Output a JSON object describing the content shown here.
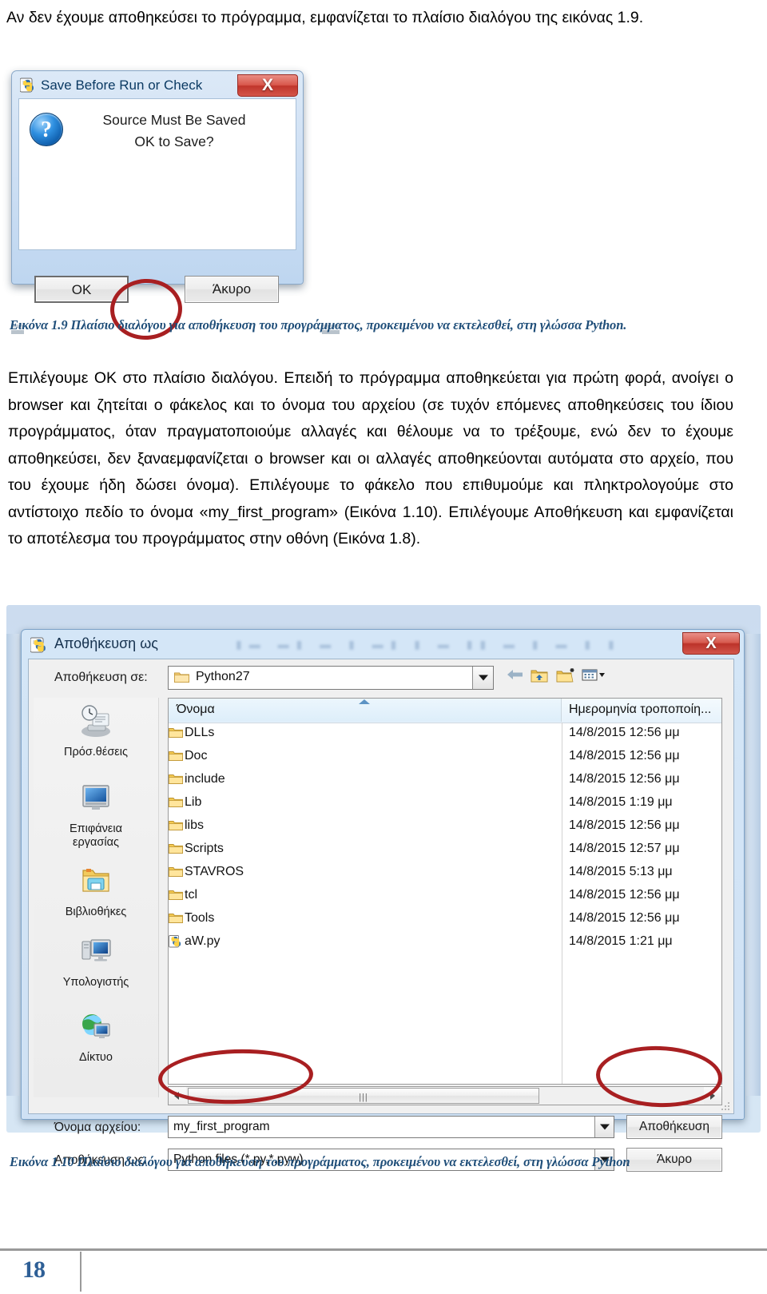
{
  "document": {
    "intro_paragraph": "Αν δεν έχουμε αποθηκεύσει το πρόγραμμα, εμφανίζεται το πλαίσιο διαλόγου της εικόνας 1.9.",
    "body_paragraph": "Επιλέγουμε ΟΚ στο πλαίσιο διαλόγου. Επειδή το πρόγραμμα αποθηκεύεται για πρώτη φορά, ανοίγει ο browser και ζητείται ο φάκελος και το όνομα του αρχείου (σε τυχόν επόμενες αποθηκεύσεις του ίδιου προγράμματος, όταν πραγματοποιούμε αλλαγές και θέλουμε να το τρέξουμε, ενώ δεν το έχουμε αποθηκεύσει, δεν ξαναεμφανίζεται ο browser και οι αλλαγές αποθηκεύονται αυτόματα στο αρχείο, που του έχουμε ήδη δώσει όνομα). Επιλέγουμε το φάκελο που επιθυμούμε και πληκτρολογούμε στο αντίστοιχο πεδίο το όνομα «my_first_program» (Εικόνα 1.10). Επιλέγουμε Αποθήκευση και εμφανίζεται το αποτέλεσμα του προγράμματος στην οθόνη (Εικόνα 1.8).",
    "caption_1_9": "Εικόνα 1.9 Πλαίσιο διαλόγου για αποθήκευση του προγράμματος, προκειμένου να εκτελεσθεί, στη γλώσσα Python.",
    "caption_1_10": "Εικόνα 1.10  Πλαίσιο διαλόγου για αποθήκευση του προγράμματος, προκειμένου να εκτελεσθεί, στη γλώσσα Python",
    "page_number": "18",
    "caption_color": "#1f4e79",
    "page_number_color": "#2e5f96",
    "annotation_color": "#a81f21"
  },
  "dialog_save_before_run": {
    "title": "Save Before Run or Check",
    "title_icon": "python-idle-icon",
    "close_label": "X",
    "message_line_1": "Source Must Be Saved",
    "message_line_2": "OK to Save?",
    "question_glyph": "?",
    "ok_label": "OK",
    "cancel_label": "Άκυρο"
  },
  "dialog_save_as": {
    "title": "Αποθήκευση ως",
    "title_icon": "python-idle-icon",
    "close_label": "X",
    "save_into_label": "Αποθήκευση σε:",
    "save_into_value": "Python27",
    "toolbar": [
      {
        "name": "back-icon",
        "tooltip": "Πίσω"
      },
      {
        "name": "up-folder-icon",
        "tooltip": "Επάνω"
      },
      {
        "name": "new-folder-icon",
        "tooltip": "Νέος φάκελος"
      },
      {
        "name": "views-icon",
        "tooltip": "Προβολές"
      }
    ],
    "places": [
      {
        "label": "Πρόσ.θέσεις",
        "icon": "recent-places-icon"
      },
      {
        "label_line1": "Επιφάνεια",
        "label_line2": "εργασίας",
        "icon": "desktop-icon"
      },
      {
        "label": "Βιβλιοθήκες",
        "icon": "libraries-icon"
      },
      {
        "label": "Υπολογιστής",
        "icon": "computer-icon"
      },
      {
        "label": "Δίκτυο",
        "icon": "network-icon"
      }
    ],
    "columns": [
      "Όνομα",
      "Ημερομηνία τροποποίη..."
    ],
    "files": [
      {
        "name": "DLLs",
        "icon": "folder-icon",
        "date": "14/8/2015 12:56 μμ"
      },
      {
        "name": "Doc",
        "icon": "folder-icon",
        "date": "14/8/2015 12:56 μμ"
      },
      {
        "name": "include",
        "icon": "folder-icon",
        "date": "14/8/2015 12:56 μμ"
      },
      {
        "name": "Lib",
        "icon": "folder-icon",
        "date": "14/8/2015 1:19 μμ"
      },
      {
        "name": "libs",
        "icon": "folder-icon",
        "date": "14/8/2015 12:56 μμ"
      },
      {
        "name": "Scripts",
        "icon": "folder-icon",
        "date": "14/8/2015 12:57 μμ"
      },
      {
        "name": "STAVROS",
        "icon": "folder-icon",
        "date": "14/8/2015 5:13 μμ"
      },
      {
        "name": "tcl",
        "icon": "folder-icon",
        "date": "14/8/2015 12:56 μμ"
      },
      {
        "name": "Tools",
        "icon": "folder-icon",
        "date": "14/8/2015 12:56 μμ"
      },
      {
        "name": "aW.py",
        "icon": "python-file-icon",
        "date": "14/8/2015 1:21 μμ"
      }
    ],
    "file_name_label": "Όνομα αρχείου:",
    "file_name_value": "my_first_program",
    "save_type_label": "Αποθήκευση ως:",
    "save_type_value": "Python files (*.py,*.pyw)",
    "save_button_label": "Αποθήκευση",
    "cancel_button_label": "Άκυρο",
    "scrollbar_grip": "|||"
  }
}
